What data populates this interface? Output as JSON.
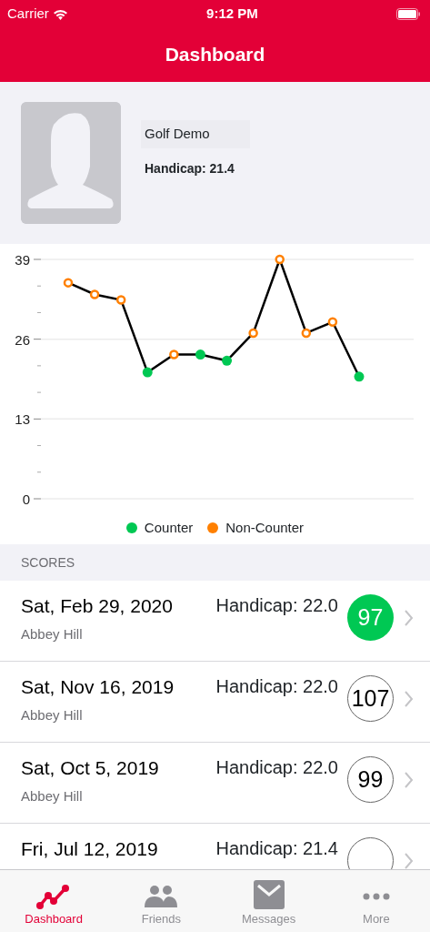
{
  "status_bar": {
    "carrier": "Carrier",
    "time": "9:12 PM"
  },
  "nav": {
    "title": "Dashboard"
  },
  "profile": {
    "name": "Golf Demo",
    "handicap": "Handicap: 21.4"
  },
  "chart": {
    "chart_data": {
      "type": "line",
      "grid": true,
      "ylim": [
        0,
        39
      ],
      "yticks": [
        0,
        13,
        26,
        39
      ],
      "series": [
        {
          "color": "#000000",
          "marker": true,
          "values": [
            35.2,
            33.3,
            32.4,
            20.6,
            23.5,
            23.5,
            22.5,
            27.0,
            39.0,
            27.0,
            28.8,
            19.9
          ]
        }
      ]
    },
    "point_counter": [
      false,
      false,
      false,
      true,
      false,
      true,
      true,
      false,
      false,
      false,
      false,
      true
    ],
    "legend": [
      {
        "label": "Counter",
        "color": "#00c853"
      },
      {
        "label": "Non-Counter",
        "color": "#ff8000"
      }
    ]
  },
  "scores_header": "SCORES",
  "scores": [
    {
      "date": "Sat, Feb 29, 2020",
      "course": "Abbey Hill",
      "handicap": "Handicap: 22.0",
      "score": "97",
      "counter": true
    },
    {
      "date": "Sat, Nov 16, 2019",
      "course": "Abbey Hill",
      "handicap": "Handicap: 22.0",
      "score": "107",
      "counter": false
    },
    {
      "date": "Sat, Oct 5, 2019",
      "course": "Abbey Hill",
      "handicap": "Handicap: 22.0",
      "score": "99",
      "counter": false
    },
    {
      "date": "Fri, Jul 12, 2019",
      "handicap": "Handicap: 21.4",
      "counter": false
    }
  ],
  "tabs": [
    {
      "label": "Dashboard",
      "kind": "chart",
      "selected": true
    },
    {
      "label": "Friends",
      "kind": "people",
      "selected": false
    },
    {
      "label": "Messages",
      "kind": "mail",
      "selected": false
    },
    {
      "label": "More",
      "kind": "dots",
      "selected": false
    }
  ]
}
